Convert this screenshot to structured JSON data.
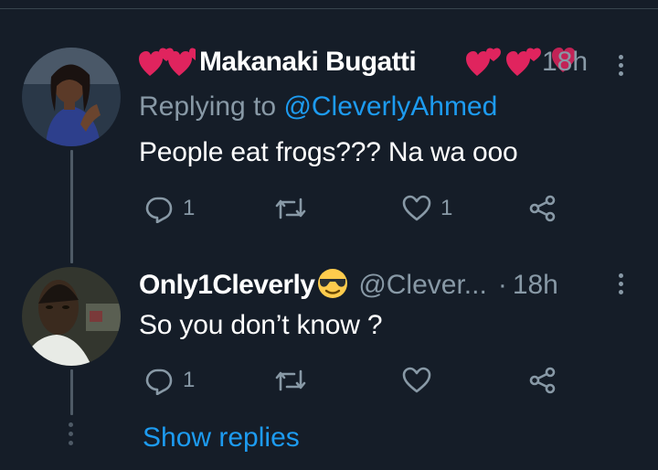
{
  "colors": {
    "background": "#151d28",
    "text_primary": "#ffffff",
    "text_secondary": "#8899a6",
    "link": "#1d9bf0",
    "heart_emoji": "#e0245e",
    "divider": "#38444d"
  },
  "tweets": [
    {
      "name": "Makanaki Bugatti",
      "name_decoration": "heart-emoji",
      "time": "18h",
      "replying_prefix": "Replying to",
      "replying_to": "@CleverlyAhmed",
      "text": "People eat frogs??? Na wa ooo",
      "reply_count": "1",
      "retweet_count": "",
      "like_count": "1",
      "icons": [
        "reply-icon",
        "retweet-icon",
        "like-icon",
        "share-icon",
        "more-options-icon"
      ]
    },
    {
      "name": "Only1Cleverly",
      "name_emoji": "sunglasses-emoji",
      "handle": "@Clever...",
      "separator": "·",
      "time": "18h",
      "text": "So you don’t know ?",
      "reply_count": "1",
      "retweet_count": "",
      "like_count": "",
      "icons": [
        "reply-icon",
        "retweet-icon",
        "like-icon",
        "share-icon",
        "more-options-icon"
      ]
    }
  ],
  "show_replies_label": "Show replies"
}
